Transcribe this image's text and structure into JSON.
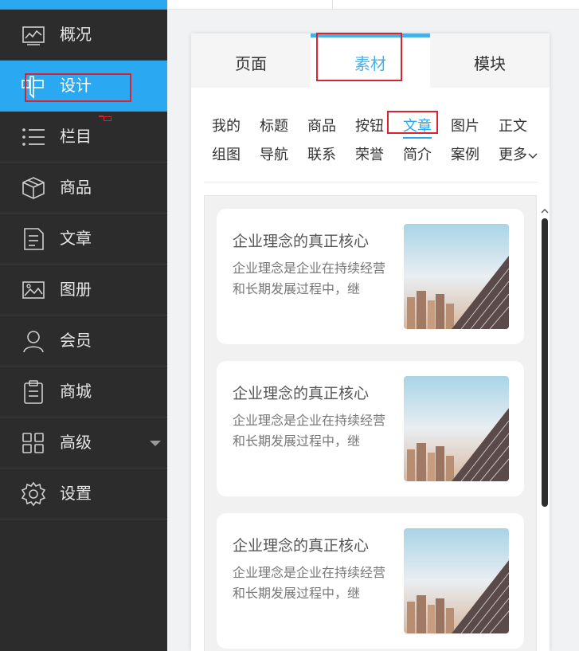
{
  "sidebar": {
    "items": [
      {
        "label": "概况",
        "icon": "chart-icon"
      },
      {
        "label": "设计",
        "icon": "design-icon"
      },
      {
        "label": "栏目",
        "icon": "list-icon"
      },
      {
        "label": "商品",
        "icon": "box-icon"
      },
      {
        "label": "文章",
        "icon": "document-icon"
      },
      {
        "label": "图册",
        "icon": "image-icon"
      },
      {
        "label": "会员",
        "icon": "user-icon"
      },
      {
        "label": "商城",
        "icon": "clipboard-icon"
      },
      {
        "label": "高级",
        "icon": "grid-icon"
      },
      {
        "label": "设置",
        "icon": "gear-icon"
      }
    ],
    "active": "设计"
  },
  "panel": {
    "tabs": [
      {
        "label": "页面"
      },
      {
        "label": "素材"
      },
      {
        "label": "模块"
      }
    ],
    "active_tab": "素材",
    "categories": {
      "row1": [
        "我的",
        "标题",
        "商品",
        "按钮",
        "文章",
        "图片",
        "正文"
      ],
      "row2": [
        "组图",
        "导航",
        "联系",
        "荣誉",
        "简介",
        "案例",
        "更多"
      ],
      "active": "文章"
    },
    "cards": [
      {
        "title": "企业理念的真正核心",
        "desc": "企业理念是企业在持续经营和长期发展过程中，继"
      },
      {
        "title": "企业理念的真正核心",
        "desc": "企业理念是企业在持续经营和长期发展过程中，继"
      },
      {
        "title": "企业理念的真正核心",
        "desc": "企业理念是企业在持续经营和长期发展过程中，继"
      }
    ]
  },
  "colors": {
    "accent": "#2aa8f2",
    "tab_accent": "#46b1e6",
    "sidebar_bg": "#2c2c2c",
    "highlight": "#d9232d"
  }
}
